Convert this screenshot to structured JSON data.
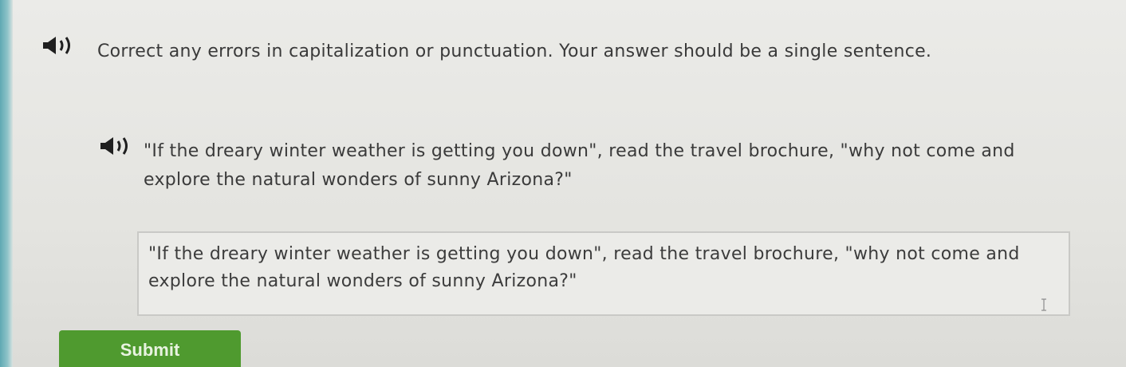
{
  "instructions": {
    "text": "Correct any errors in capitalization or punctuation. Your answer should be a single sentence."
  },
  "question": {
    "text": "\"If the dreary winter weather is getting you down\", read the travel brochure, \"why not come and explore the natural wonders of sunny Arizona?\""
  },
  "answer": {
    "value": "\"If the dreary winter weather is getting you down\", read the travel brochure, \"why not come and explore the natural wonders of sunny Arizona?\""
  },
  "submit": {
    "label": "Submit"
  },
  "icons": {
    "audio": "speaker-icon",
    "text_cursor": "text-cursor-icon"
  },
  "colors": {
    "submit_bg": "#4f9a2f",
    "icon": "#2b2b2b"
  }
}
